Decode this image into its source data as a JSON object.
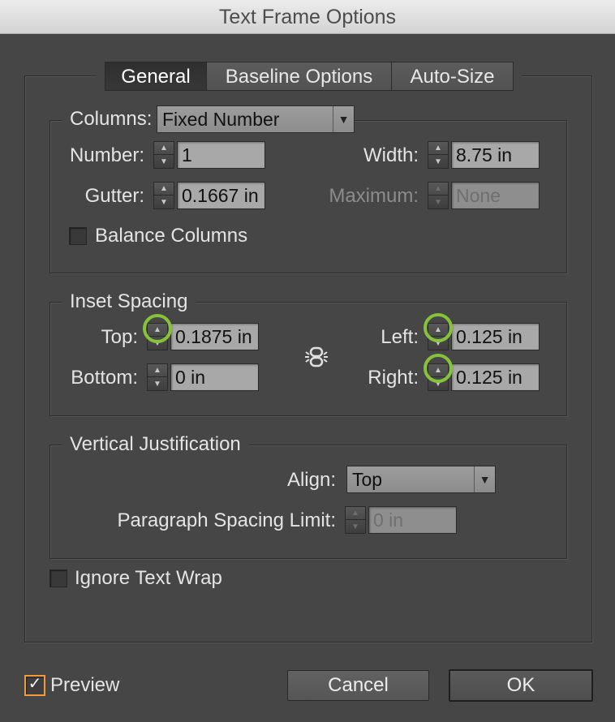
{
  "window": {
    "title": "Text Frame Options"
  },
  "tabs": [
    {
      "label": "General",
      "active": true
    },
    {
      "label": "Baseline Options",
      "active": false
    },
    {
      "label": "Auto-Size",
      "active": false
    }
  ],
  "columns": {
    "legend": "Columns:",
    "mode": "Fixed Number",
    "number_label": "Number:",
    "number_value": "1",
    "width_label": "Width:",
    "width_value": "8.75 in",
    "gutter_label": "Gutter:",
    "gutter_value": "0.1667 in",
    "maximum_label": "Maximum:",
    "maximum_value": "None",
    "balance_label": "Balance Columns",
    "balance_checked": false
  },
  "inset": {
    "legend": "Inset Spacing",
    "top_label": "Top:",
    "top_value": "0.1875 in",
    "bottom_label": "Bottom:",
    "bottom_value": "0 in",
    "left_label": "Left:",
    "left_value": "0.125 in",
    "right_label": "Right:",
    "right_value": "0.125 in",
    "link_icon": "chain-link-icon"
  },
  "vertical": {
    "legend": "Vertical Justification",
    "align_label": "Align:",
    "align_value": "Top",
    "spacing_label": "Paragraph Spacing Limit:",
    "spacing_value": "0 in"
  },
  "ignore_wrap": {
    "label": "Ignore Text Wrap",
    "checked": false
  },
  "preview": {
    "label": "Preview",
    "checked": true
  },
  "buttons": {
    "cancel": "Cancel",
    "ok": "OK"
  },
  "colors": {
    "background": "#464646",
    "highlight_ring": "#86c33a",
    "checkbox_accent": "#f39a3a"
  }
}
